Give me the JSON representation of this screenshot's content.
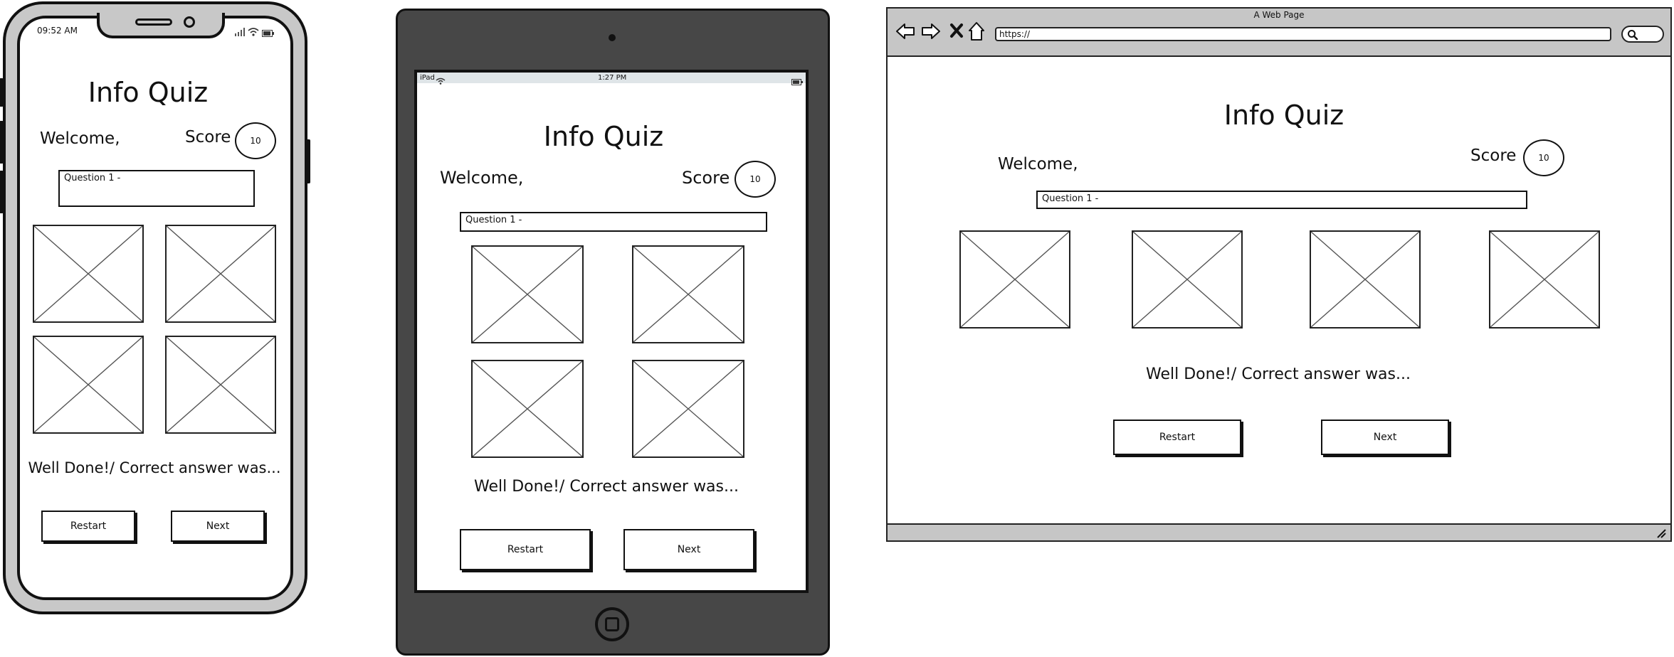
{
  "phone": {
    "status_time": "09:52 AM",
    "title": "Info Quiz",
    "welcome": "Welcome,",
    "score_label": "Score",
    "score_value": "10",
    "question": "Question 1 -",
    "feedback": "Well Done!/ Correct answer was...",
    "restart_label": "Restart",
    "next_label": "Next"
  },
  "tablet": {
    "status_device": "iPad",
    "status_time": "1:27 PM",
    "title": "Info Quiz",
    "welcome": "Welcome,",
    "score_label": "Score",
    "score_value": "10",
    "question": "Question 1 -",
    "feedback": "Well Done!/ Correct answer was...",
    "restart_label": "Restart",
    "next_label": "Next"
  },
  "browser": {
    "window_title": "A Web Page",
    "url": "https://",
    "title": "Info Quiz",
    "welcome": "Welcome,",
    "score_label": "Score",
    "score_value": "10",
    "question": "Question 1 -",
    "feedback": "Well Done!/ Correct answer was...",
    "restart_label": "Restart",
    "next_label": "Next"
  }
}
